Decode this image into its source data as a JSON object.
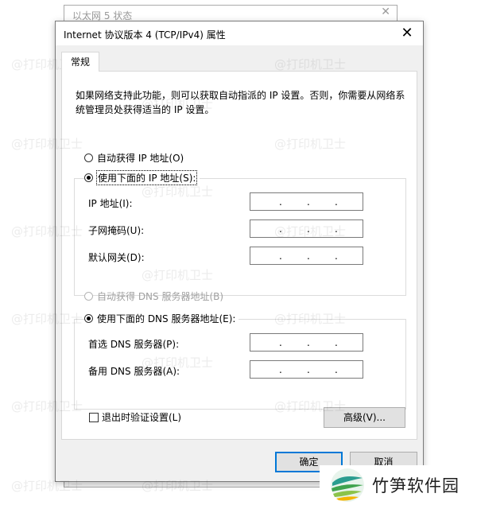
{
  "background_window": {
    "title": "以太网 5 状态"
  },
  "dialog": {
    "title": "Internet 协议版本 4 (TCP/IPv4) 属性",
    "tab_label": "常规",
    "description": "如果网络支持此功能，则可以获取自动指派的 IP 设置。否则，你需要从网络系统管理员处获得适当的 IP 设置。",
    "ip_section": {
      "auto_label": "自动获得 IP 地址(O)",
      "manual_label": "使用下面的 IP 地址(S):",
      "selected": "manual",
      "fields": [
        {
          "label": "IP 地址(I):",
          "value": ". . ."
        },
        {
          "label": "子网掩码(U):",
          "value": ". . ."
        },
        {
          "label": "默认网关(D):",
          "value": ". . ."
        }
      ]
    },
    "dns_section": {
      "auto_label": "自动获得 DNS 服务器地址(B)",
      "auto_disabled": true,
      "manual_label": "使用下面的 DNS 服务器地址(E):",
      "selected": "manual",
      "fields": [
        {
          "label": "首选 DNS 服务器(P):",
          "value": ". . ."
        },
        {
          "label": "备用 DNS 服务器(A):",
          "value": ". . ."
        }
      ]
    },
    "validate_checkbox": {
      "label": "退出时验证设置(L)",
      "checked": false
    },
    "advanced_button": "高级(V)...",
    "ok_button": "确定",
    "cancel_button": "取消",
    "close_symbol": "✕"
  },
  "watermark_text": "@打印机卫士",
  "brand": {
    "name": "竹笋软件园"
  },
  "colors": {
    "accent": "#0078d7",
    "dialog_bg": "#f0f0f0",
    "panel_bg": "#ffffff"
  }
}
